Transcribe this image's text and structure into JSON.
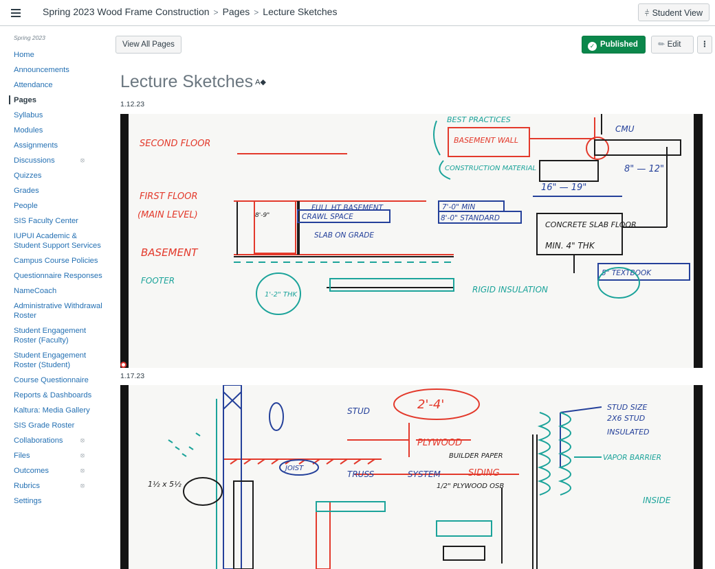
{
  "header": {
    "breadcrumb": [
      "Spring 2023 Wood Frame Construction",
      "Pages",
      "Lecture Sketches"
    ],
    "student_view_label": "Student View"
  },
  "nav": {
    "term": "Spring 2023",
    "items": [
      {
        "label": "Home"
      },
      {
        "label": "Announcements"
      },
      {
        "label": "Attendance"
      },
      {
        "label": "Pages",
        "active": true
      },
      {
        "label": "Syllabus"
      },
      {
        "label": "Modules"
      },
      {
        "label": "Assignments"
      },
      {
        "label": "Discussions",
        "hidden": true
      },
      {
        "label": "Quizzes"
      },
      {
        "label": "Grades"
      },
      {
        "label": "People"
      },
      {
        "label": "SIS Faculty Center"
      },
      {
        "label": "IUPUI Academic & Student Support Services"
      },
      {
        "label": "Campus Course Policies"
      },
      {
        "label": "Questionnaire Responses"
      },
      {
        "label": "NameCoach"
      },
      {
        "label": "Administrative Withdrawal Roster"
      },
      {
        "label": "Student Engagement Roster (Faculty)"
      },
      {
        "label": "Student Engagement Roster (Student)"
      },
      {
        "label": "Course Questionnaire"
      },
      {
        "label": "Reports & Dashboards"
      },
      {
        "label": "Kaltura: Media Gallery"
      },
      {
        "label": "SIS Grade Roster"
      },
      {
        "label": "Collaborations",
        "hidden": true
      },
      {
        "label": "Files",
        "hidden": true
      },
      {
        "label": "Outcomes",
        "hidden": true
      },
      {
        "label": "Rubrics",
        "hidden": true
      },
      {
        "label": "Settings"
      }
    ]
  },
  "toolbar": {
    "view_all_label": "View All Pages",
    "published_label": "Published",
    "edit_label": "Edit",
    "more_label": "⋮"
  },
  "page": {
    "title": "Lecture Sketches",
    "sections": [
      {
        "date": "1.12.23",
        "labels": {
          "second_floor": "SECOND FLOOR",
          "first_floor": "FIRST FLOOR",
          "main_level": "(MAIN LEVEL)",
          "basement": "BASEMENT",
          "footer": "FOOTER",
          "best_practices": "BEST PRACTICES",
          "basement_wall": "BASEMENT WALL",
          "construction_material": "CONSTRUCTION MATERIAL",
          "cmu": "CMU",
          "full_ht_basement": "FULL HT BASEMENT",
          "crawl_space": "CRAWL SPACE",
          "slab_on_grade": "SLAB ON GRADE",
          "min_7": "7'-0\" MIN",
          "standard_8": "8'-0\" STANDARD",
          "concrete_slab": "CONCRETE SLAB FLOOR",
          "min_4": "MIN. 4\" THK",
          "textbook": "5\" TEXTBOOK",
          "rigid_insulation": "RIGID INSULATION",
          "thk_1_2": "1'-2\" THK",
          "dim_16_19": "16\" — 19\"",
          "dim_8_12": "8\" — 12\"",
          "dim_8_9": "8'-9\""
        }
      },
      {
        "date": "1.17.23",
        "labels": {
          "stud": "STUD",
          "range_2_4": "2'-4'",
          "plywood": "PLYWOOD",
          "stud_size": "STUD SIZE",
          "stud_2x6": "2X6 STUD",
          "insulated": "INSULATED",
          "builder_paper": "BUILDER PAPER",
          "vapor_barrier": "VAPOR BARRIER",
          "joist": "JOIST",
          "truss": "TRUSS",
          "system": "SYSTEM",
          "siding": "SIDING",
          "osb": "1/2\" PLYWOOD OSB",
          "inside": "INSIDE",
          "sill": "1½ x 5½"
        }
      }
    ]
  }
}
